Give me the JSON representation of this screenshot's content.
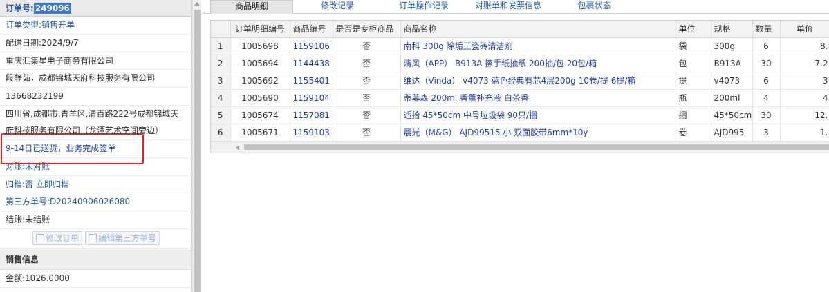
{
  "order": {
    "label": "订单号:",
    "number": "249096"
  },
  "info_rows": [
    {
      "label": "订单类型:",
      "value": "销售开单",
      "blue": true
    },
    {
      "label": "配送日期:",
      "value": "2024/9/7",
      "blue": false
    },
    {
      "label": "",
      "value": "重庆汇集星电子商务有限公司",
      "blue": false
    },
    {
      "label": "",
      "value": "段静茹，成都锦城天府科技服务有限公司",
      "blue": false
    },
    {
      "label": "",
      "value": "13668232199",
      "blue": false
    }
  ],
  "address": "四川省,成都市,青羊区,清百路222号成都锦城天府科技服务有限公司（龙潭艺术空间旁边）",
  "highlight_note": "9-14日已送货，业务完成签单",
  "status_rows": [
    {
      "label": "对账:",
      "value": "未对账"
    },
    {
      "label": "归档:",
      "value": "否 立即归档"
    },
    {
      "label": "第三方单号:",
      "value": "D20240906026080"
    },
    {
      "label": "结账:",
      "value": "未结账"
    }
  ],
  "buttons": {
    "modify_order": "修改订单",
    "edit_third_party": "编辑第三方单号"
  },
  "sales_section": {
    "title": "销售信息",
    "amount_label": "金额:",
    "amount_value": "1026.0000"
  },
  "tabs": [
    "商品明细",
    "修改记录",
    "订单操作记录",
    "对账单和发票信息",
    "包裹状态"
  ],
  "active_tab": 0,
  "table": {
    "headers": [
      "",
      "订单明细编号",
      "商品编号",
      "是否是专柜商品",
      "商品名称",
      "单位",
      "规格",
      "数量",
      "单价"
    ],
    "rows": [
      [
        "1",
        "1005698",
        "1159106",
        "否",
        "南科 300g 除垢王瓷砖清洁剂",
        "袋",
        "300g",
        "6",
        "8."
      ],
      [
        "2",
        "1005694",
        "1144438",
        "否",
        "清风（APP） B913A 擦手纸抽纸 200抽/包 20包/箱",
        "包",
        "B913A",
        "30",
        "7.2"
      ],
      [
        "3",
        "1005692",
        "1155401",
        "否",
        "维达（Vinda） v4073 蓝色经典有芯4层200g 10卷/提 6提/箱",
        "提",
        "v4073",
        "6",
        "3"
      ],
      [
        "4",
        "1005690",
        "1159104",
        "否",
        "蒂菲森 200ml 香薰补充液 白茶香",
        "瓶",
        "200ml",
        "4",
        "4"
      ],
      [
        "5",
        "1005674",
        "1157081",
        "否",
        "适拾 45*50cm 中号垃圾袋 90只/捆",
        "捆",
        "45*50cm",
        "30",
        "12."
      ],
      [
        "6",
        "1005671",
        "1159103",
        "否",
        "晨光（M&G） AJD99515 小 双面胶带6mm*10y",
        "卷",
        "AJD995",
        "3",
        "1."
      ]
    ]
  }
}
